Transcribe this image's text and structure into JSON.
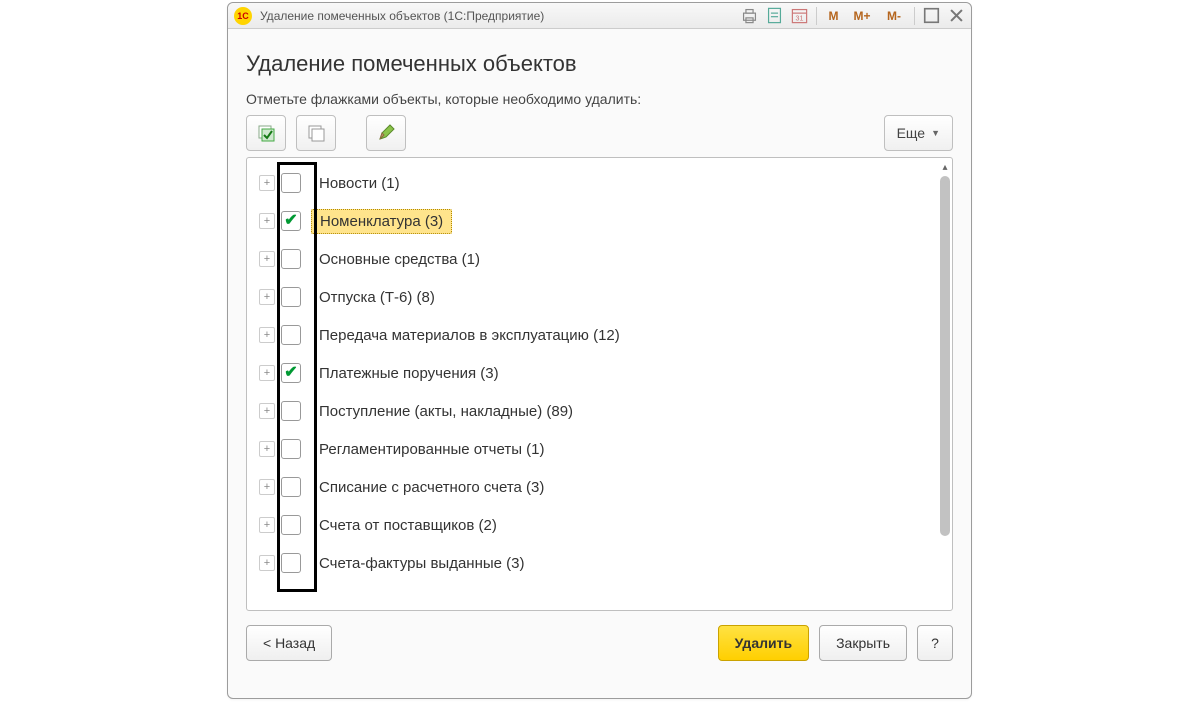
{
  "window": {
    "logo_text": "1C",
    "title": "Удаление помеченных объектов  (1С:Предприятие)"
  },
  "titlebar_labels": {
    "m": "M",
    "m_plus": "M+",
    "m_minus": "M-"
  },
  "page": {
    "heading": "Удаление помеченных объектов",
    "instruction": "Отметьте флажками объекты, которые необходимо удалить:"
  },
  "toolbar": {
    "more_label": "Еще"
  },
  "items": [
    {
      "label": "Новости (1)",
      "checked": false,
      "highlight": false
    },
    {
      "label": "Номенклатура (3)",
      "checked": true,
      "highlight": true
    },
    {
      "label": "Основные средства (1)",
      "checked": false,
      "highlight": false
    },
    {
      "label": "Отпуска (Т-6) (8)",
      "checked": false,
      "highlight": false
    },
    {
      "label": "Передача материалов в эксплуатацию (12)",
      "checked": false,
      "highlight": false
    },
    {
      "label": "Платежные поручения (3)",
      "checked": true,
      "highlight": false
    },
    {
      "label": "Поступление (акты, накладные) (89)",
      "checked": false,
      "highlight": false
    },
    {
      "label": "Регламентированные отчеты (1)",
      "checked": false,
      "highlight": false
    },
    {
      "label": "Списание с расчетного счета (3)",
      "checked": false,
      "highlight": false
    },
    {
      "label": "Счета от поставщиков (2)",
      "checked": false,
      "highlight": false
    },
    {
      "label": "Счета-фактуры выданные (3)",
      "checked": false,
      "highlight": false
    }
  ],
  "footer": {
    "back": "< Назад",
    "delete": "Удалить",
    "close": "Закрыть",
    "help": "?"
  }
}
